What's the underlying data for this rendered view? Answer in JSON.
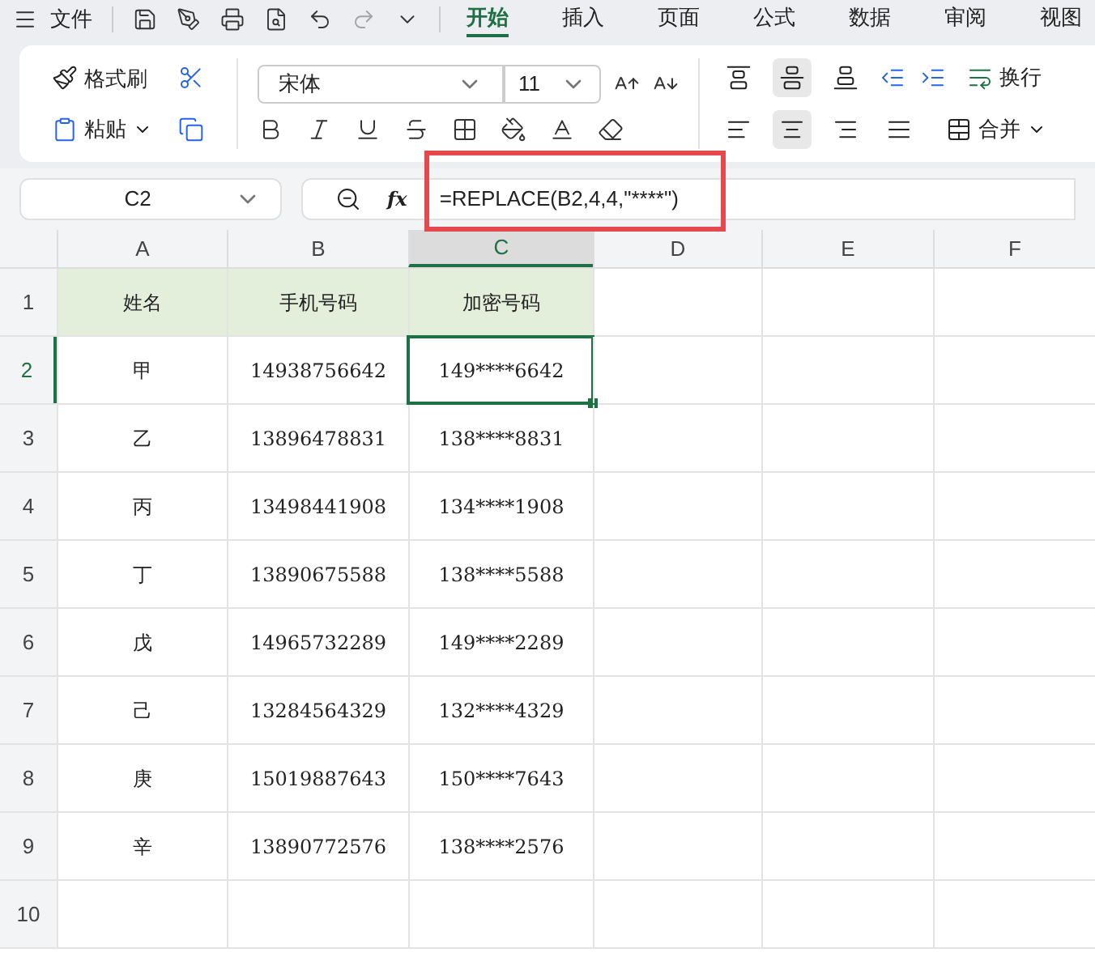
{
  "menu": {
    "file": "文件"
  },
  "tabs": [
    {
      "label": "开始",
      "selected": true
    },
    {
      "label": "插入",
      "selected": false
    },
    {
      "label": "页面",
      "selected": false
    },
    {
      "label": "公式",
      "selected": false
    },
    {
      "label": "数据",
      "selected": false
    },
    {
      "label": "审阅",
      "selected": false
    },
    {
      "label": "视图",
      "selected": false
    }
  ],
  "ribbon": {
    "format_painter": "格式刷",
    "paste": "粘贴",
    "font_name": "宋体",
    "font_size": "11",
    "wrap": "换行",
    "merge": "合并",
    "vertical_align": [
      {
        "selected": false
      },
      {
        "selected": true
      },
      {
        "selected": false
      }
    ],
    "horizontal_align": [
      {
        "selected": false
      },
      {
        "selected": true
      },
      {
        "selected": false
      },
      {
        "selected": false
      }
    ]
  },
  "formula_bar": {
    "name_box": "C2",
    "fx_label": "fx",
    "formula": "=REPLACE(B2,4,4,\"****\")",
    "highlighted": true
  },
  "sheet": {
    "columns": [
      {
        "label": "A",
        "selected": false
      },
      {
        "label": "B",
        "selected": false
      },
      {
        "label": "C",
        "selected": true
      },
      {
        "label": "D",
        "selected": false
      },
      {
        "label": "E",
        "selected": false
      },
      {
        "label": "F",
        "selected": false
      }
    ],
    "rows": [
      {
        "number": "1",
        "selected": false,
        "kind": "header",
        "cells": [
          {
            "value": "姓名",
            "selected": false
          },
          {
            "value": "手机号码",
            "selected": false
          },
          {
            "value": "加密号码",
            "selected": false
          }
        ]
      },
      {
        "number": "2",
        "selected": true,
        "kind": "data",
        "cells": [
          {
            "value": "甲",
            "selected": false
          },
          {
            "value": "14938756642",
            "selected": false
          },
          {
            "value": "149****6642",
            "selected": true
          }
        ]
      },
      {
        "number": "3",
        "selected": false,
        "kind": "data",
        "cells": [
          {
            "value": "乙",
            "selected": false
          },
          {
            "value": "13896478831",
            "selected": false
          },
          {
            "value": "138****8831",
            "selected": false
          }
        ]
      },
      {
        "number": "4",
        "selected": false,
        "kind": "data",
        "cells": [
          {
            "value": "丙",
            "selected": false
          },
          {
            "value": "13498441908",
            "selected": false
          },
          {
            "value": "134****1908",
            "selected": false
          }
        ]
      },
      {
        "number": "5",
        "selected": false,
        "kind": "data",
        "cells": [
          {
            "value": "丁",
            "selected": false
          },
          {
            "value": "13890675588",
            "selected": false
          },
          {
            "value": "138****5588",
            "selected": false
          }
        ]
      },
      {
        "number": "6",
        "selected": false,
        "kind": "data",
        "cells": [
          {
            "value": "戊",
            "selected": false
          },
          {
            "value": "14965732289",
            "selected": false
          },
          {
            "value": "149****2289",
            "selected": false
          }
        ]
      },
      {
        "number": "7",
        "selected": false,
        "kind": "data",
        "cells": [
          {
            "value": "己",
            "selected": false
          },
          {
            "value": "13284564329",
            "selected": false
          },
          {
            "value": "132****4329",
            "selected": false
          }
        ]
      },
      {
        "number": "8",
        "selected": false,
        "kind": "data",
        "cells": [
          {
            "value": "庚",
            "selected": false
          },
          {
            "value": "15019887643",
            "selected": false
          },
          {
            "value": "150****7643",
            "selected": false
          }
        ]
      },
      {
        "number": "9",
        "selected": false,
        "kind": "data",
        "cells": [
          {
            "value": "辛",
            "selected": false
          },
          {
            "value": "13890772576",
            "selected": false
          },
          {
            "value": "138****2576",
            "selected": false
          }
        ]
      },
      {
        "number": "10",
        "selected": false,
        "kind": "data",
        "cells": []
      }
    ]
  }
}
